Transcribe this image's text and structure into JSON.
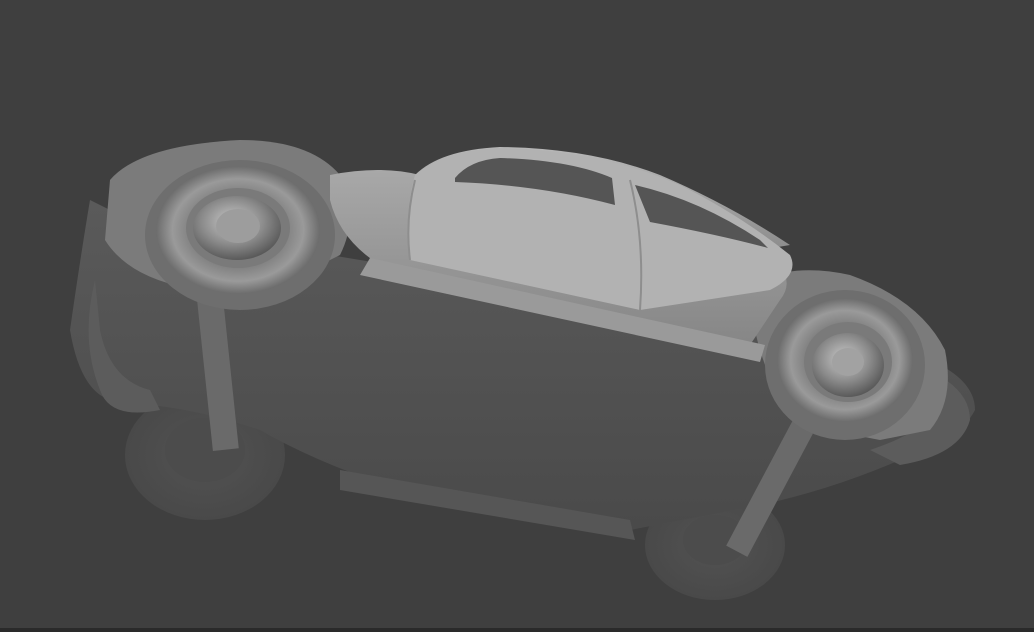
{
  "viewport": {
    "background_color": "#3f3f3f",
    "model_color": "#8f8f8f",
    "model_shading": "solid",
    "object": "car-model",
    "view": "upside-down"
  }
}
